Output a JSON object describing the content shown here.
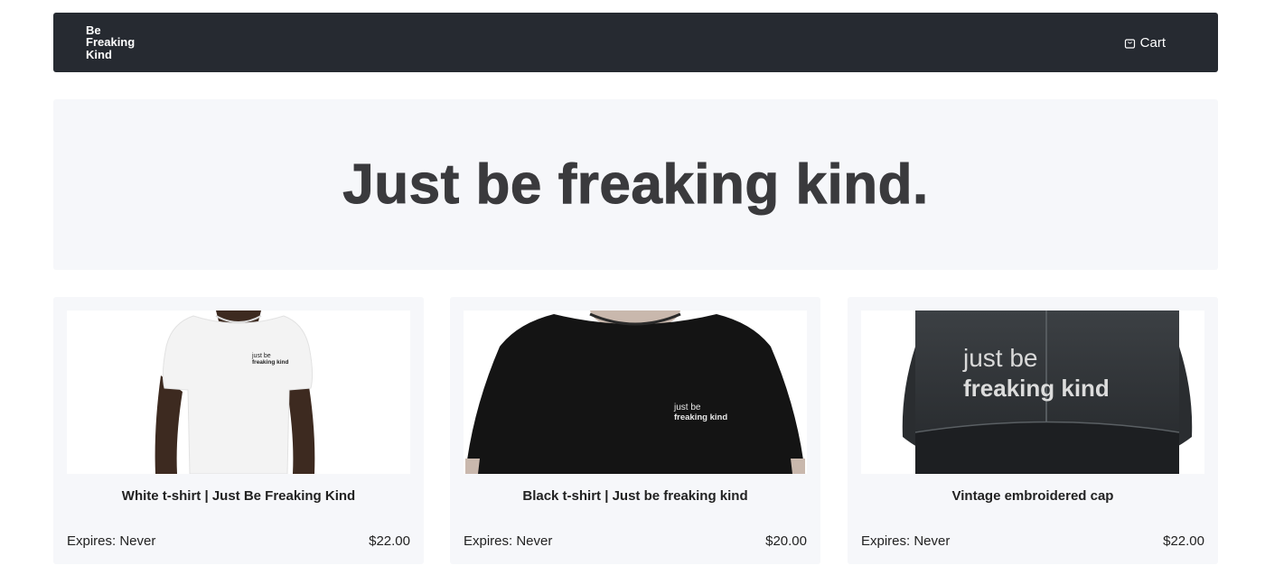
{
  "header": {
    "logo_lines": [
      "Be",
      "Freaking",
      "Kind"
    ],
    "cart_label": "Cart",
    "cart_icon": "shopping-bag-icon"
  },
  "hero": {
    "headline": "Just be freaking kind."
  },
  "products": [
    {
      "title": "White t-shirt | Just Be Freaking Kind",
      "expires": "Expires: Never",
      "price": "$22.00",
      "print_line1": "just be",
      "print_line2": "freaking kind"
    },
    {
      "title": "Black t-shirt | Just be freaking kind",
      "expires": "Expires: Never",
      "price": "$20.00",
      "print_line1": "just be",
      "print_line2": "freaking kind"
    },
    {
      "title": "Vintage embroidered cap",
      "expires": "Expires: Never",
      "price": "$22.00",
      "print_line1": "just be",
      "print_line2": "freaking kind"
    }
  ],
  "colors": {
    "navbar": "#262a31",
    "panel": "#f6f7fa",
    "headline": "#3a3a3d"
  }
}
